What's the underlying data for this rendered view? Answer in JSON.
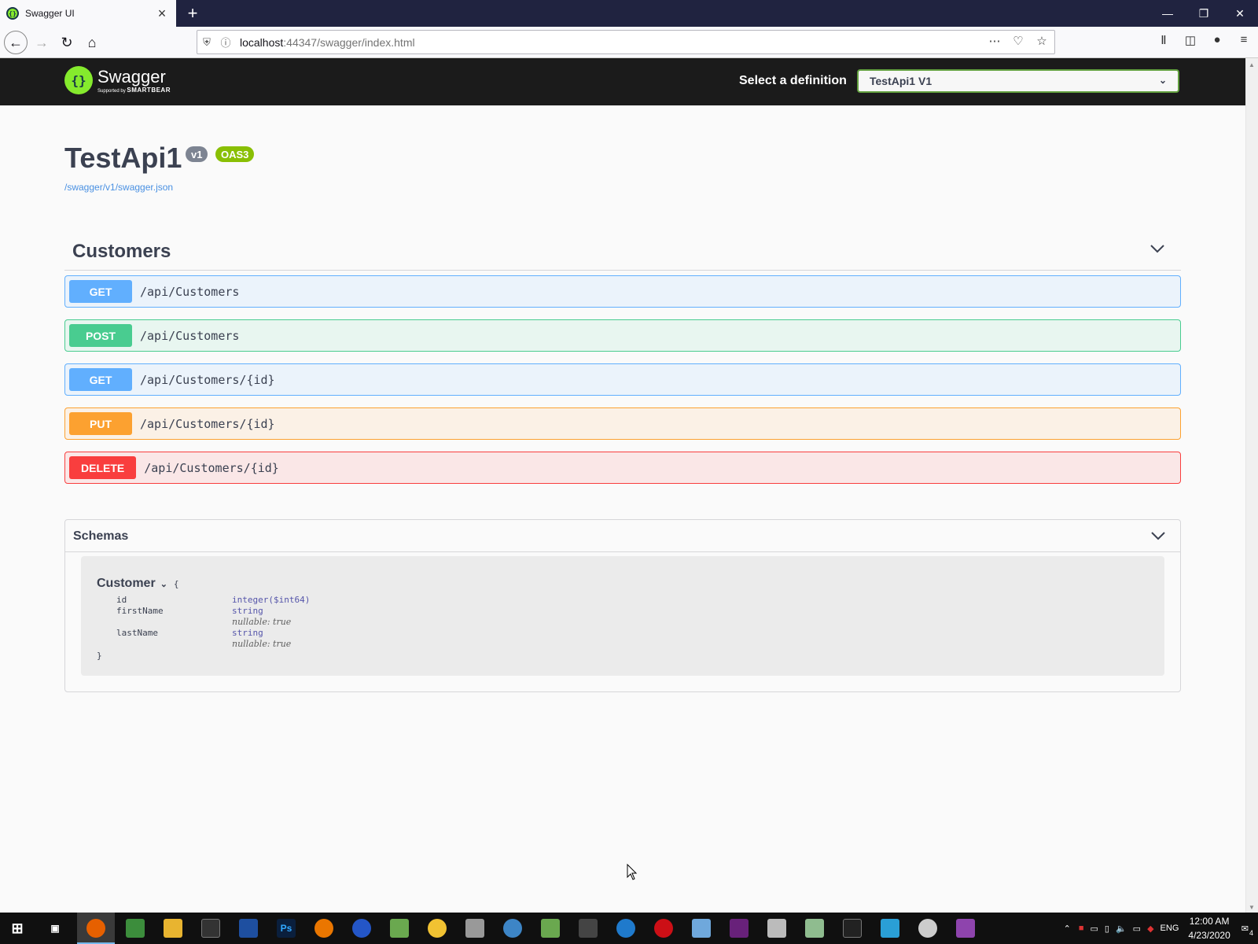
{
  "browser": {
    "tab_title": "Swagger UI",
    "url_host": "localhost",
    "url_rest": ":44347/swagger/index.html",
    "new_tab_label": "+",
    "tab_close_label": "×"
  },
  "topbar": {
    "logo_name": "Swagger",
    "logo_sub_prefix": "Supported by",
    "logo_sub_brand": "SMARTBEAR",
    "definition_label": "Select a definition",
    "definition_value": "TestApi1 V1"
  },
  "info": {
    "title": "TestApi1",
    "version_badge": "v1",
    "oas_badge": "OAS3",
    "spec_link": "/swagger/v1/swagger.json"
  },
  "tag": {
    "name": "Customers",
    "operations": [
      {
        "method": "GET",
        "path": "/api/Customers"
      },
      {
        "method": "POST",
        "path": "/api/Customers"
      },
      {
        "method": "GET",
        "path": "/api/Customers/{id}"
      },
      {
        "method": "PUT",
        "path": "/api/Customers/{id}"
      },
      {
        "method": "DELETE",
        "path": "/api/Customers/{id}"
      }
    ]
  },
  "schemas": {
    "title": "Schemas",
    "model": {
      "name": "Customer",
      "open_brace": "{",
      "close_brace": "}",
      "properties": [
        {
          "name": "id",
          "type": "integer($int64)",
          "nullable": ""
        },
        {
          "name": "firstName",
          "type": "string",
          "nullable": "nullable: true"
        },
        {
          "name": "lastName",
          "type": "string",
          "nullable": "nullable: true"
        }
      ]
    }
  },
  "taskbar": {
    "time": "12:00 AM",
    "date": "4/23/2020",
    "language": "ENG",
    "notifications": "4"
  },
  "colors": {
    "get": "#61affe",
    "post": "#49cc90",
    "put": "#fca130",
    "delete": "#f93e3e",
    "swagger_green": "#85ea2d"
  }
}
